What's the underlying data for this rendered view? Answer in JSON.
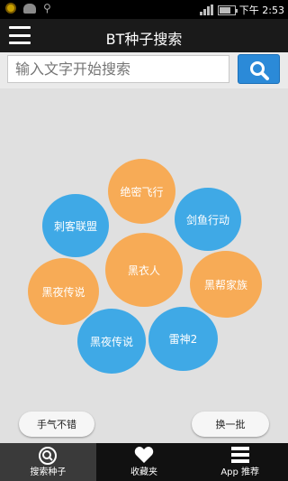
{
  "status_bar": {
    "time": "下午 2:53",
    "battery_level": 0.75,
    "icons": [
      "notification-icon",
      "android-debug-icon",
      "usb-icon",
      "signal-icon",
      "battery-icon"
    ]
  },
  "header": {
    "title": "BT种子搜索",
    "menu_icon": "hamburger-menu-icon"
  },
  "search": {
    "placeholder": "输入文字开始搜索",
    "value": "",
    "button_icon": "search-icon"
  },
  "bubbles": [
    {
      "label": "绝密飞行",
      "color": "orange"
    },
    {
      "label": "刺客联盟",
      "color": "blue"
    },
    {
      "label": "剑鱼行动",
      "color": "blue"
    },
    {
      "label": "黑衣人",
      "color": "orange"
    },
    {
      "label": "黑夜传说",
      "color": "orange"
    },
    {
      "label": "黑帮家族",
      "color": "orange"
    },
    {
      "label": "黑夜传说",
      "color": "blue"
    },
    {
      "label": "雷神2",
      "color": "blue"
    }
  ],
  "actions": {
    "lucky_label": "手气不错",
    "refresh_label": "换一批"
  },
  "nav": {
    "items": [
      {
        "label": "搜索种子",
        "icon": "search-circle-icon",
        "active": true
      },
      {
        "label": "收藏夹",
        "icon": "heart-icon",
        "active": false
      },
      {
        "label": "App 推荐",
        "icon": "list-icon",
        "active": false
      }
    ]
  },
  "colors": {
    "orange": "#f7ab56",
    "blue": "#3fa9e6",
    "search_button": "#2b8ad8",
    "background": "#e0e0e0"
  }
}
